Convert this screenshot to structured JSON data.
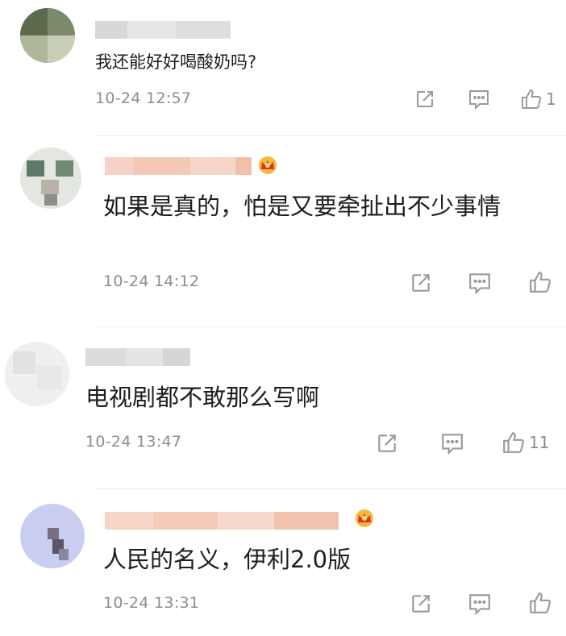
{
  "comments": [
    {
      "text": "我还能好好喝酸奶吗?",
      "time": "10-24 12:57",
      "likes": "1",
      "vip": false
    },
    {
      "text": "如果是真的，怕是又要牵扯出不少事情",
      "time": "10-24 14:12",
      "likes": "",
      "vip": true
    },
    {
      "text": "电视剧都不敢那么写啊",
      "time": "10-24 13:47",
      "likes": "11",
      "vip": false
    },
    {
      "text": "人民的名义，伊利2.0版",
      "time": "10-24 13:31",
      "likes": "",
      "vip": true
    }
  ],
  "icons": {
    "share": "share-icon",
    "reply": "reply-icon",
    "like": "thumbs-up-icon",
    "crown": "crown-badge-icon"
  },
  "colors": {
    "text": "#1e1e1e",
    "meta": "#8d8d8d",
    "icon": "#9a9a9a",
    "crown": "#f0a020",
    "divider": "#ececec"
  }
}
